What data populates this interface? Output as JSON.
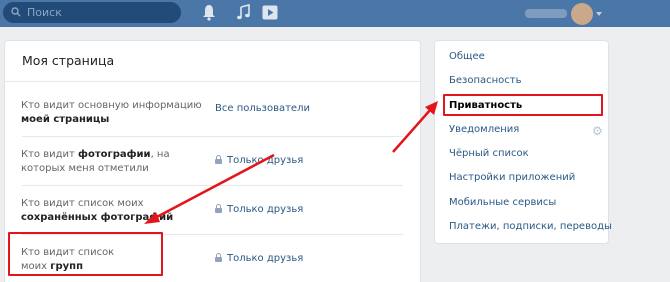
{
  "topbar": {
    "search_placeholder": "Поиск",
    "icons": [
      "search-icon",
      "bell-icon",
      "music-note-icon",
      "video-play-icon"
    ],
    "background": "#4a76a8"
  },
  "main": {
    "title": "Моя страница",
    "rows": [
      {
        "question_plain": "Кто видит основную информацию ",
        "question_bold": "моей страницы",
        "value": "Все пользователи",
        "locked": false
      },
      {
        "question_plain": "Кто видит ",
        "question_bold": "фотографии",
        "question_tail": ", на которых меня отметили",
        "value": "Только друзья",
        "locked": true
      },
      {
        "question_plain": "Кто видит список моих ",
        "question_bold": "сохранённых фотографий",
        "value": "Только друзья",
        "locked": true
      },
      {
        "question_plain": "Кто видит список моих ",
        "question_bold": "групп",
        "value": "Только друзья",
        "locked": true
      }
    ]
  },
  "sidebar": {
    "items": [
      {
        "label": "Общее",
        "active": false
      },
      {
        "label": "Безопасность",
        "active": false
      },
      {
        "label": "Приватность",
        "active": true
      },
      {
        "label": "Уведомления",
        "active": false
      },
      {
        "label": "Чёрный список",
        "active": false
      },
      {
        "label": "Настройки приложений",
        "active": false
      },
      {
        "label": "Мобильные сервисы",
        "active": false
      },
      {
        "label": "Платежи, подписки, переводы",
        "active": false
      }
    ]
  },
  "colors": {
    "link": "#2a5885",
    "annotation": "#e3151b"
  }
}
